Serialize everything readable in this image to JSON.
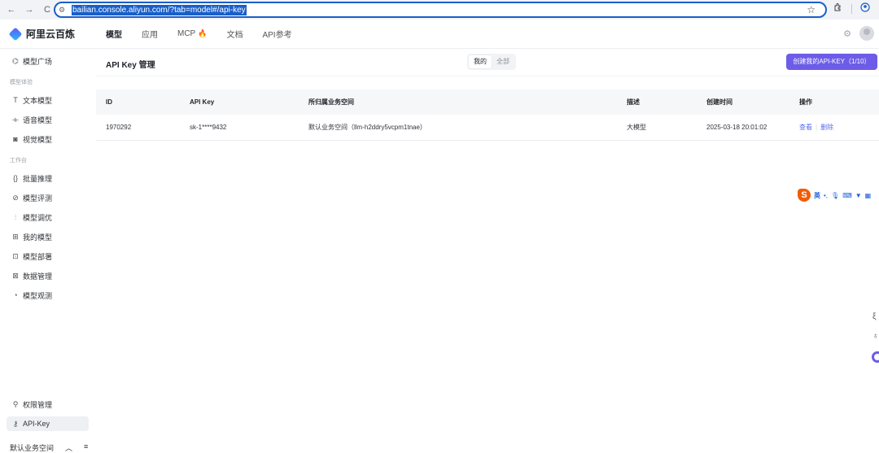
{
  "browser": {
    "back_icon": "←",
    "forward_icon": "→",
    "reload_icon": "C",
    "site_icon": "⚙",
    "url": "bailian.console.aliyun.com/?tab=model#/api-key",
    "star_icon": "☆"
  },
  "topnav": {
    "logo_text": "阿里云百炼",
    "tabs": [
      {
        "label": "模型"
      },
      {
        "label": "应用"
      },
      {
        "label": "MCP"
      },
      {
        "label": "文档"
      },
      {
        "label": "API参考"
      }
    ],
    "mcp_fire_icon": "🔥"
  },
  "sidebar": {
    "item_model_square": "模型广场",
    "group_experience": "模型体验",
    "item_text_model": "文本模型",
    "item_voice_model": "语音模型",
    "item_vision_model": "视觉模型",
    "group_workbench": "工作台",
    "item_batch_inference": "批量推理",
    "item_model_eval": "模型评测",
    "item_model_tuning": "模型调优",
    "item_my_models": "我的模型",
    "item_model_deploy": "模型部署",
    "item_data_mgmt": "数据管理",
    "item_model_observe": "模型观测",
    "item_permission": "权限管理",
    "item_api_key": "API-Key",
    "workspace": "默认业务空间"
  },
  "main": {
    "title": "API Key 管理",
    "segment_mine": "我的",
    "segment_all": "全部",
    "create_button": "创建我的API-KEY（1/10）",
    "table": {
      "headers": [
        "ID",
        "API Key",
        "所归属业务空间",
        "描述",
        "创建时间",
        "操作"
      ],
      "rows": [
        {
          "id": "1970292",
          "key": "sk-1****9432",
          "workspace": "默认业务空间（llm-h2ddry5vcpm1tnae）",
          "desc": "大模型",
          "created": "2025-03-18 20:01:02",
          "view": "查看",
          "delete": "删除"
        }
      ]
    }
  },
  "ime": {
    "logo": "S",
    "lang": "英"
  },
  "colors": {
    "accent": "#6c5ce7",
    "link": "#5a6cf0",
    "url_highlight": "#1a5fc9"
  }
}
